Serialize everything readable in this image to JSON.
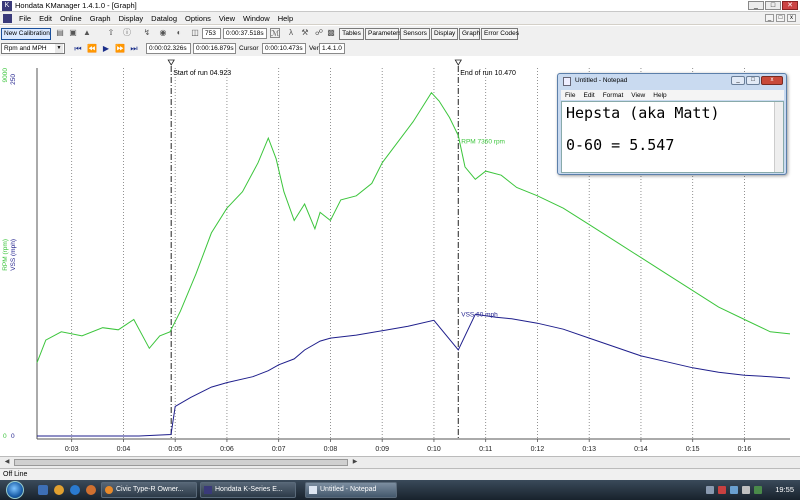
{
  "window": {
    "title": "Hondata KManager 1.4.1.0 - [Graph]",
    "controls": [
      "_",
      "□",
      "✕"
    ]
  },
  "menu": [
    "File",
    "Edit",
    "Online",
    "Graph",
    "Display",
    "Datalog",
    "Options",
    "View",
    "Window",
    "Help"
  ],
  "toolbar": {
    "new_calibration": "New Calibration",
    "frame_value": "753",
    "time_total": "0:00:37.518s",
    "tabs": [
      "Tables",
      "Parameters",
      "Sensors",
      "Display",
      "Graph",
      "Error Codes"
    ]
  },
  "toolbar2": {
    "selected_view": "Rpm and MPH",
    "time_start": "0:00:02.326s",
    "time_end": "0:00:16.879s",
    "cursor_label": "Cursor",
    "cursor_value": "0:00:10.473s",
    "version_label": "Ver",
    "version_value": "1.4.1.0"
  },
  "graph": {
    "start_marker": "Start of run 04.923",
    "end_marker": "End of run 10.470",
    "rpm_label": "RPM 7360 rpm",
    "vss_label": "VSS 60 mph",
    "axis_rpm": "RPM (rpm)",
    "axis_vss": "VSS (mph)",
    "axis_top_rpm": "9000",
    "axis_top_vss": "250",
    "axis_bottom_rpm": "0",
    "axis_bottom_vss": "0",
    "colors": {
      "rpm": "#3cc53c",
      "vss": "#1f1f8c"
    }
  },
  "chart_data": {
    "type": "line",
    "x_ticks": [
      "0:03",
      "0:04",
      "0:05",
      "0:06",
      "0:07",
      "0:08",
      "0:09",
      "0:10",
      "0:11",
      "0:12",
      "0:13",
      "0:14",
      "0:15",
      "0:16"
    ],
    "start_run": 4.923,
    "end_run": 10.47,
    "ylim_rpm": [
      0,
      9000
    ],
    "ylim_vss": [
      0,
      250
    ],
    "series": [
      {
        "name": "RPM",
        "unit": "rpm",
        "x": [
          2.33,
          2.5,
          2.8,
          3.2,
          3.6,
          3.9,
          4.2,
          4.5,
          4.7,
          4.9,
          5.1,
          5.4,
          5.7,
          6.0,
          6.3,
          6.6,
          6.8,
          6.95,
          7.1,
          7.3,
          7.5,
          7.7,
          7.8,
          8.0,
          8.2,
          8.5,
          8.8,
          9.0,
          9.3,
          9.6,
          9.8,
          9.95,
          10.1,
          10.3,
          10.47,
          10.6,
          10.8,
          11.0,
          11.3,
          11.6,
          12.0,
          12.5,
          13.0,
          13.5,
          14.0,
          14.5,
          15.0,
          15.5,
          16.0,
          16.5,
          16.88
        ],
        "values": [
          1850,
          2400,
          2600,
          2500,
          2700,
          2650,
          2900,
          2200,
          2500,
          2600,
          3100,
          4000,
          5000,
          5600,
          6000,
          6700,
          7300,
          6800,
          6000,
          5300,
          5700,
          5100,
          5500,
          5300,
          5800,
          5900,
          6200,
          6700,
          7200,
          7700,
          8100,
          8400,
          8200,
          7800,
          7360,
          6600,
          6300,
          6500,
          6400,
          6100,
          5900,
          5600,
          5200,
          4800,
          4400,
          4000,
          3600,
          3200,
          2900,
          2600,
          2550
        ]
      },
      {
        "name": "VSS",
        "unit": "mph",
        "x": [
          2.33,
          4.3,
          4.92,
          5.0,
          5.3,
          5.7,
          6.0,
          6.5,
          6.8,
          7.0,
          7.3,
          7.5,
          7.8,
          8.0,
          8.5,
          9.0,
          9.5,
          10.0,
          10.47,
          10.8,
          11.2,
          11.5,
          12.0,
          12.5,
          13.0,
          13.5,
          14.0,
          14.5,
          15.0,
          15.5,
          16.0,
          16.5,
          16.88
        ],
        "values": [
          2,
          2,
          3,
          22,
          28,
          35,
          38,
          42,
          46,
          50,
          54,
          60,
          66,
          68,
          70,
          73,
          76,
          80,
          60,
          84,
          82,
          81,
          78,
          74,
          68,
          62,
          56,
          52,
          48,
          45,
          43,
          42,
          41
        ]
      }
    ]
  },
  "notepad": {
    "title": "Untitled - Notepad",
    "menu": [
      "File",
      "Edit",
      "Format",
      "View",
      "Help"
    ],
    "lines": [
      "Hepsta (aka Matt)",
      "0-60 = 5.547"
    ]
  },
  "status": {
    "text": "Off Line"
  },
  "taskbar": {
    "items": [
      "Civic Type-R Owner...",
      "Hondata K-Series E...",
      "Untitled - Notepad"
    ],
    "clock": "19:55"
  }
}
